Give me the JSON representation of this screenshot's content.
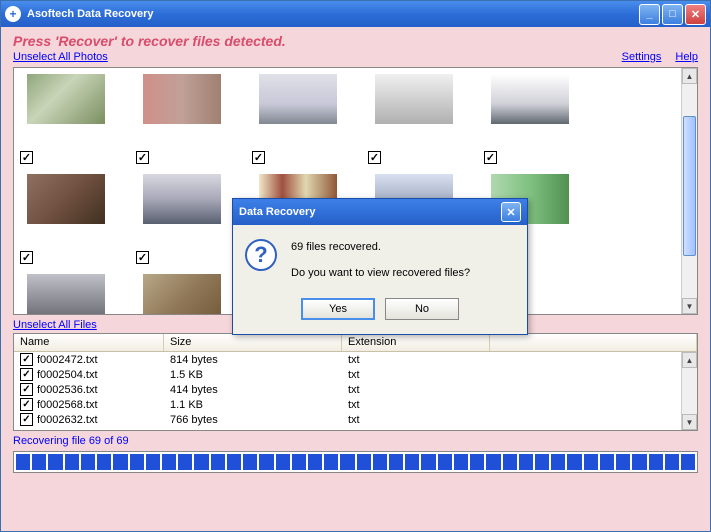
{
  "app": {
    "title": "Asoftech Data Recovery"
  },
  "instruction": "Press 'Recover' to recover files detected.",
  "links": {
    "unselect_photos": "Unselect All Photos",
    "settings": "Settings",
    "help": "Help",
    "unselect_files": "Unselect All Files"
  },
  "file_table": {
    "headers": {
      "name": "Name",
      "size": "Size",
      "ext": "Extension"
    },
    "rows": [
      {
        "name": "f0002472.txt",
        "size": "814 bytes",
        "ext": "txt"
      },
      {
        "name": "f0002504.txt",
        "size": "1.5 KB",
        "ext": "txt"
      },
      {
        "name": "f0002536.txt",
        "size": "414 bytes",
        "ext": "txt"
      },
      {
        "name": "f0002568.txt",
        "size": "1.1 KB",
        "ext": "txt"
      },
      {
        "name": "f0002632.txt",
        "size": "766 bytes",
        "ext": "txt"
      }
    ]
  },
  "status": "Recovering file 69 of 69",
  "dialog": {
    "title": "Data Recovery",
    "line1": "69 files recovered.",
    "line2": "Do you want to view recovered files?",
    "yes": "Yes",
    "no": "No"
  }
}
